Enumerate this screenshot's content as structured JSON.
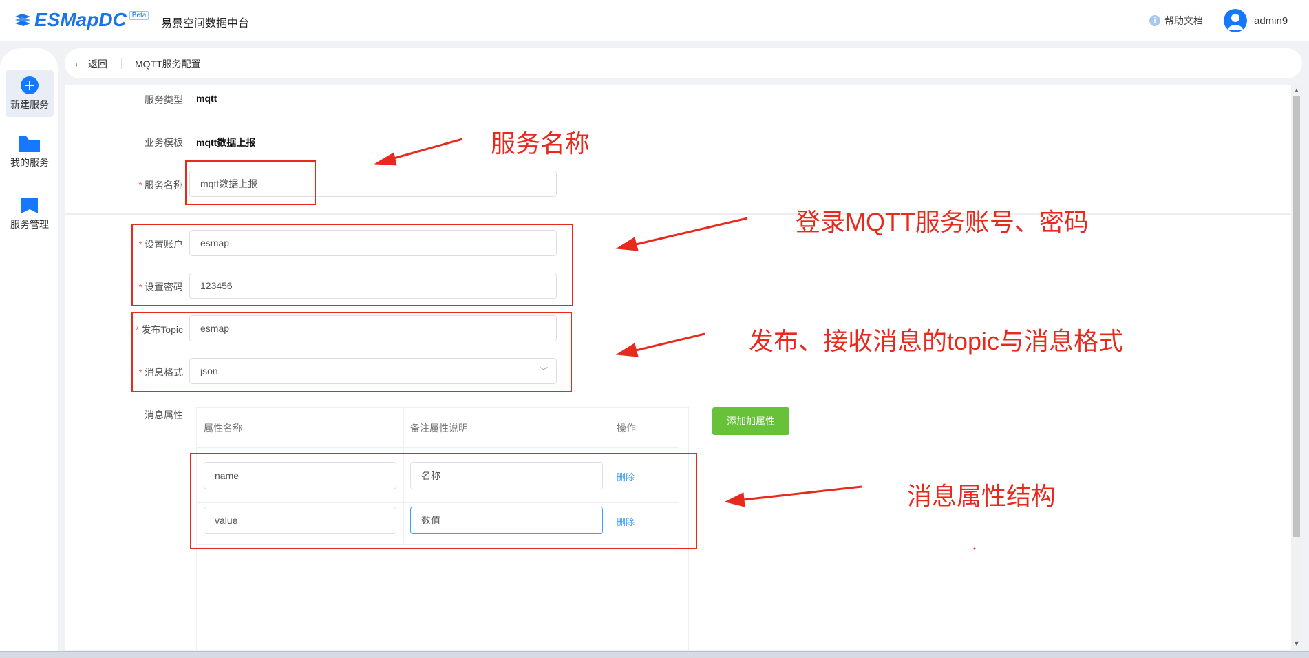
{
  "header": {
    "logo_text": "ESMapDC",
    "logo_badge": "Beta",
    "app_name": "易景空间数据中台",
    "help_label": "帮助文档",
    "username": "admin9"
  },
  "sidebar": {
    "items": [
      {
        "label": "新建服务",
        "icon": "plus-circle-icon"
      },
      {
        "label": "我的服务",
        "icon": "folder-icon"
      },
      {
        "label": "服务管理",
        "icon": "book-icon"
      }
    ]
  },
  "breadcrumb": {
    "back_label": "返回",
    "title": "MQTT服务配置"
  },
  "form": {
    "service_type_label": "服务类型",
    "service_type_value": "mqtt",
    "template_label": "业务模板",
    "template_value": "mqtt数据上报",
    "service_name_label": "服务名称",
    "service_name_value": "mqtt数据上报",
    "account_label": "设置账户",
    "account_value": "esmap",
    "password_label": "设置密码",
    "password_value": "123456",
    "topic_label": "发布Topic",
    "topic_value": "esmap",
    "format_label": "消息格式",
    "format_value": "json",
    "props_label": "消息属性"
  },
  "table": {
    "headers": [
      "属性名称",
      "备注属性说明",
      "操作"
    ],
    "rows": [
      {
        "name": "name",
        "desc": "名称",
        "action": "删除"
      },
      {
        "name": "value",
        "desc": "数值",
        "action": "删除"
      }
    ],
    "add_button": "添加加属性"
  },
  "annotations": {
    "service_name": "服务名称",
    "login": "登录MQTT服务账号、密码",
    "topic_format": "发布、接收消息的topic与消息格式",
    "props_structure": "消息属性结构"
  },
  "colors": {
    "brand": "#1a73e8",
    "annotation_red": "#e8291d",
    "add_button_green": "#67c23a",
    "link_blue": "#409eff"
  }
}
